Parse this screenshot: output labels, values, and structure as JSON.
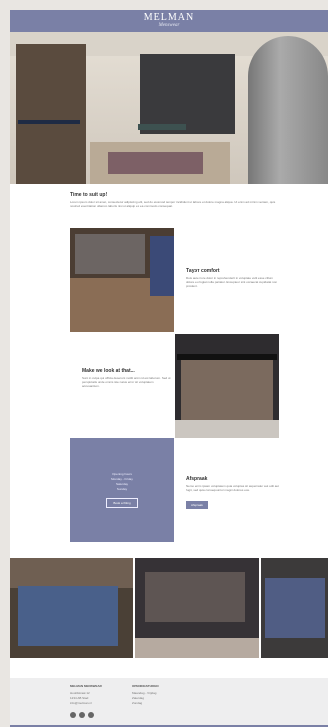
{
  "header": {
    "logo_main": "MELMAN",
    "logo_sub": "Menswear"
  },
  "section1": {
    "title": "Time to suit up!",
    "text": "Lorem ipsum dolor sit amet, consectetur adipiscing elit, sed do eiusmod tempor incididunt ut labore et dolore magna aliqua. Ut enim ad minim veniam, quis nostrud exercitation ullamco laboris nisi ut aliquip ex ea commodo consequat."
  },
  "section2": {
    "title": "Тауэт comfort",
    "text": "Duis aute irure dolor in reprehenderit in voluptate velit esse cillum dolore eu fugiat nulla pariatur. Excepteur sint occaecat cupidatat non proident."
  },
  "section3": {
    "title": "Make we look at that...",
    "text": "Sunt in culpa qui officia deserunt mollit anim id est laborum. Sed ut perspiciatis unde omnis iste natus error sit voluptatem accusantium."
  },
  "blue_block": {
    "lines": [
      "Opening hours",
      "Monday - Friday",
      "Saturday",
      "Sunday"
    ],
    "button": "Book a fitting"
  },
  "section4": {
    "title": "Afspraak",
    "text": "Nemo enim ipsam voluptatem quia voluptas sit aspernatur aut odit aut fugit, sed quia consequuntur magni dolores eos.",
    "button": "Afspraak"
  },
  "footer": {
    "col1_title": "MELMAN MENSWEAR",
    "col1_lines": [
      "Hoofdstraat 12",
      "1234 AB Stad",
      "info@melman.nl"
    ],
    "col2_title": "OPENINGSTIJDEN",
    "col2_lines": [
      "Maandag - Vrijdag",
      "Zaterdag",
      "Zondag"
    ]
  }
}
